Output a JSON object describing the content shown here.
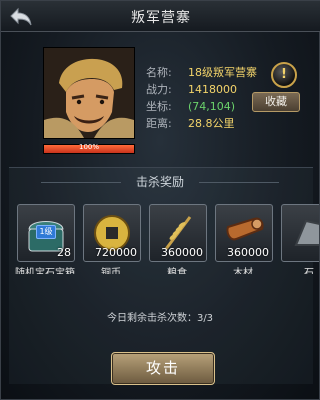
{
  "window": {
    "title": "叛军营寨"
  },
  "target": {
    "hp_percent_text": "100%",
    "hp_fraction": 1.0,
    "fields": [
      {
        "label": "名称:",
        "value": "18级叛军营寨"
      },
      {
        "label": "战力:",
        "value": "1418000"
      },
      {
        "label": "坐标:",
        "value": "(74,104)"
      },
      {
        "label": "距离:",
        "value": "28.8公里"
      }
    ],
    "favorite_label": "收藏",
    "info_icon_text": "!"
  },
  "rewards": {
    "title": "击杀奖励",
    "items": [
      {
        "name": "随机宝石宝箱",
        "count": "28",
        "icon": "treasure-chest-icon",
        "badge": "1级"
      },
      {
        "name": "铜币",
        "count": "720000",
        "icon": "copper-coin-icon"
      },
      {
        "name": "粮食",
        "count": "360000",
        "icon": "wheat-icon"
      },
      {
        "name": "木材",
        "count": "360000",
        "icon": "wood-log-icon"
      },
      {
        "name": "石",
        "count": "",
        "icon": "stone-icon"
      }
    ]
  },
  "kills_remaining_text": "今日剩余击杀次数：3/3",
  "attack_label": "攻击",
  "colors": {
    "accent_gold": "#f2d36a",
    "coords_green": "#6bd36b",
    "hp_red": "#d8442a"
  }
}
